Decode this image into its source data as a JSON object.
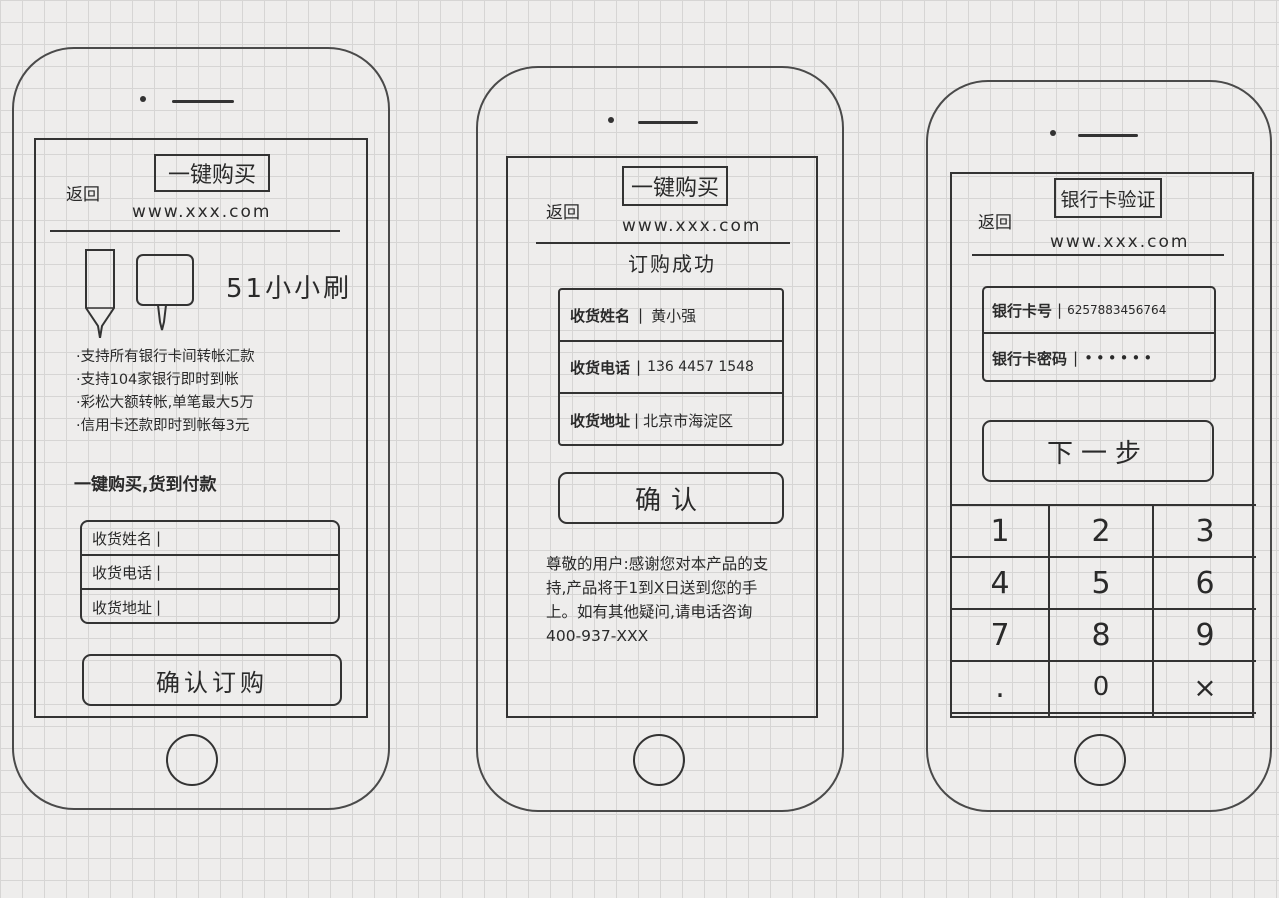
{
  "screen1": {
    "back": "返回",
    "title": "一键购买",
    "url": "www.xxx.com",
    "product_name": "51小小刷",
    "features": [
      "·支持所有银行卡间转帐汇款",
      "·支持104家银行即时到帐",
      "·彩松大额转帐,单笔最大5万",
      "·信用卡还款即时到帐每3元"
    ],
    "promo": "一键购买,货到付款",
    "form_rows": [
      "收货姓名",
      "收货电话",
      "收货地址"
    ],
    "confirm_button": "确认订购"
  },
  "screen2": {
    "back": "返回",
    "title": "一键购买",
    "url": "www.xxx.com",
    "status": "订购成功",
    "rows": [
      {
        "label": "收货姓名",
        "value": "黄小强"
      },
      {
        "label": "收货电话",
        "value": "136 4457 1548"
      },
      {
        "label": "收货地址",
        "value": "北京市海淀区"
      }
    ],
    "confirm_button": "确认",
    "message": "尊敬的用户:感谢您对本产品的支持,产品将于1到X日送到您的手上。如有其他疑问,请电话咨询 400-937-XXX"
  },
  "screen3": {
    "back": "返回",
    "title": "银行卡验证",
    "url": "www.xxx.com",
    "rows": [
      {
        "label": "银行卡号",
        "value": "6257883456764"
      },
      {
        "label": "银行卡密码",
        "value": "••••••"
      }
    ],
    "next_button": "下一步",
    "keypad": [
      "1",
      "2",
      "3",
      "4",
      "5",
      "6",
      "7",
      "8",
      "9",
      ".",
      "0",
      "×"
    ]
  }
}
